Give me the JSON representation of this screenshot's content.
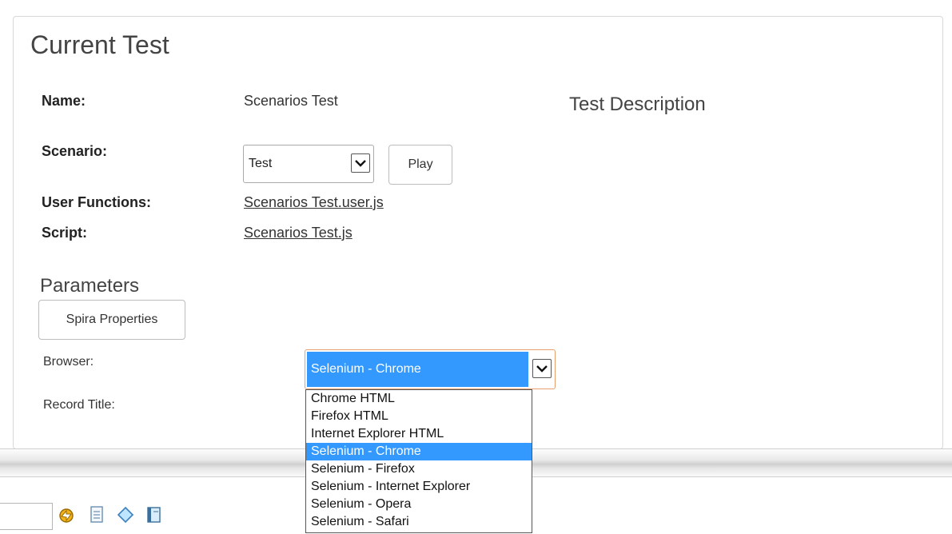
{
  "header": {
    "title": "Current Test"
  },
  "details": {
    "name_label": "Name:",
    "name_value": "Scenarios Test",
    "scenario_label": "Scenario:",
    "scenario_value": "Test",
    "play_label": "Play",
    "user_functions_label": "User Functions:",
    "user_functions_link": "Scenarios Test.user.js",
    "script_label": "Script:",
    "script_link": "Scenarios Test.js"
  },
  "description": {
    "title": "Test Description"
  },
  "parameters": {
    "title": "Parameters",
    "spira_button": "Spira Properties",
    "browser_label": "Browser:",
    "browser_value": "Selenium - Chrome",
    "record_title_label": "Record Title:",
    "browser_options": [
      "Chrome HTML",
      "Firefox HTML",
      "Internet Explorer HTML",
      "Selenium - Chrome",
      "Selenium - Firefox",
      "Selenium - Internet Explorer",
      "Selenium - Opera",
      "Selenium - Safari"
    ],
    "selected_index": 3
  },
  "toolbar": {
    "icons": [
      "run-icon",
      "document-icon",
      "tag-icon",
      "book-icon"
    ]
  },
  "colors": {
    "highlight": "#3399ff",
    "focus_border": "#e8a070"
  }
}
